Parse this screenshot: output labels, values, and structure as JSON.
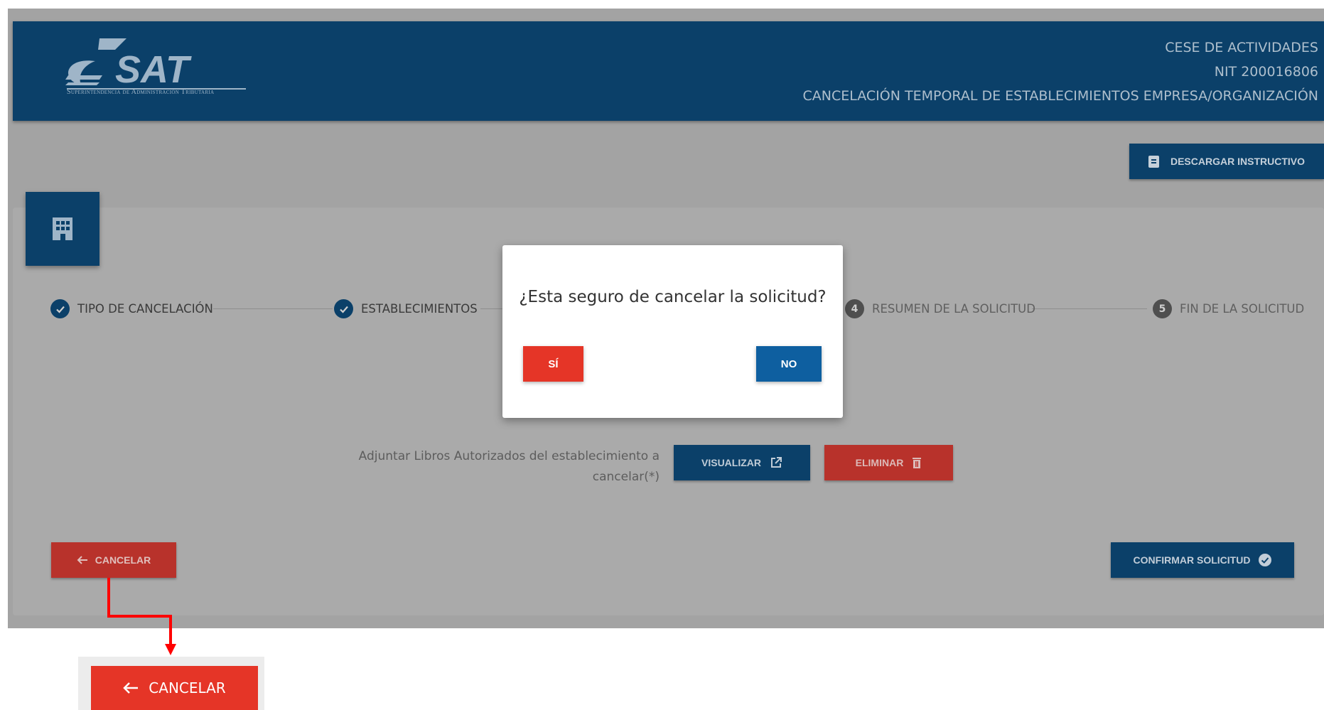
{
  "header": {
    "logo_text": "SAT",
    "logo_subtitle": "Superintendencia de Administración Tributaria",
    "lines": [
      "CESE DE ACTIVIDADES",
      "NIT 200016806",
      "CANCELACIÓN TEMPORAL DE ESTABLECIMIENTOS EMPRESA/ORGANIZACIÓN"
    ]
  },
  "toolbar": {
    "download_label": "DESCARGAR INSTRUCTIVO"
  },
  "stepper": {
    "steps": [
      {
        "label": "TIPO DE CANCELACIÓN",
        "state": "done"
      },
      {
        "label": "ESTABLECIMIENTOS",
        "state": "done"
      },
      {
        "number": "4",
        "label": "RESUMEN DE LA SOLICITUD",
        "state": "pending"
      },
      {
        "number": "5",
        "label": "FIN DE LA SOLICITUD",
        "state": "pending"
      }
    ]
  },
  "attachment": {
    "label": "Adjuntar Libros Autorizados del establecimiento a cancelar(*)",
    "view_label": "VISUALIZAR",
    "delete_label": "ELIMINAR"
  },
  "actions": {
    "cancel_label": "CANCELAR",
    "confirm_label": "CONFIRMAR SOLICITUD"
  },
  "dialog": {
    "question": "¿Esta seguro de cancelar la solicitud?",
    "yes_label": "SÍ",
    "no_label": "NO"
  },
  "callout": {
    "cancel_label": "CANCELAR"
  },
  "colors": {
    "primary": "#0b4069",
    "danger": "#e53527",
    "dialog_no": "#0e5fa0",
    "overlay": "#a3a3a3",
    "annotation_arrow": "#ff0000"
  }
}
